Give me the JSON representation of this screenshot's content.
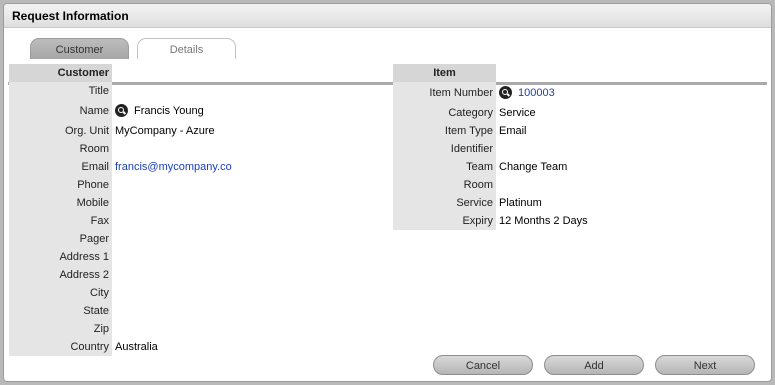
{
  "window": {
    "title": "Request Information"
  },
  "tabs": [
    {
      "label": "Customer"
    },
    {
      "label": "Details"
    }
  ],
  "customer": {
    "header": "Customer",
    "fields": [
      {
        "label": "Title",
        "value": ""
      },
      {
        "label": "Name",
        "value": "Francis Young"
      },
      {
        "label": "Org. Unit",
        "value": "MyCompany - Azure"
      },
      {
        "label": "Room",
        "value": ""
      },
      {
        "label": "Email",
        "value": "francis@mycompany.co"
      },
      {
        "label": "Phone",
        "value": ""
      },
      {
        "label": "Mobile",
        "value": ""
      },
      {
        "label": "Fax",
        "value": ""
      },
      {
        "label": "Pager",
        "value": ""
      },
      {
        "label": "Address 1",
        "value": ""
      },
      {
        "label": "Address 2",
        "value": ""
      },
      {
        "label": "City",
        "value": ""
      },
      {
        "label": "State",
        "value": ""
      },
      {
        "label": "Zip",
        "value": ""
      },
      {
        "label": "Country",
        "value": "Australia"
      }
    ]
  },
  "item": {
    "header": "Item",
    "fields": [
      {
        "label": "Item Number",
        "value": "100003"
      },
      {
        "label": "Category",
        "value": "Service"
      },
      {
        "label": "Item Type",
        "value": "Email"
      },
      {
        "label": "Identifier",
        "value": ""
      },
      {
        "label": "Team",
        "value": "Change Team"
      },
      {
        "label": "Room",
        "value": ""
      },
      {
        "label": "Service",
        "value": "Platinum"
      },
      {
        "label": "Expiry",
        "value": "12 Months 2 Days"
      }
    ]
  },
  "buttons": {
    "cancel": "Cancel",
    "add": "Add",
    "next": "Next"
  },
  "icons": {
    "lookup": "search-icon"
  },
  "colors": {
    "link": "#1b3fb8",
    "label_bg": "#e5e5e5"
  }
}
